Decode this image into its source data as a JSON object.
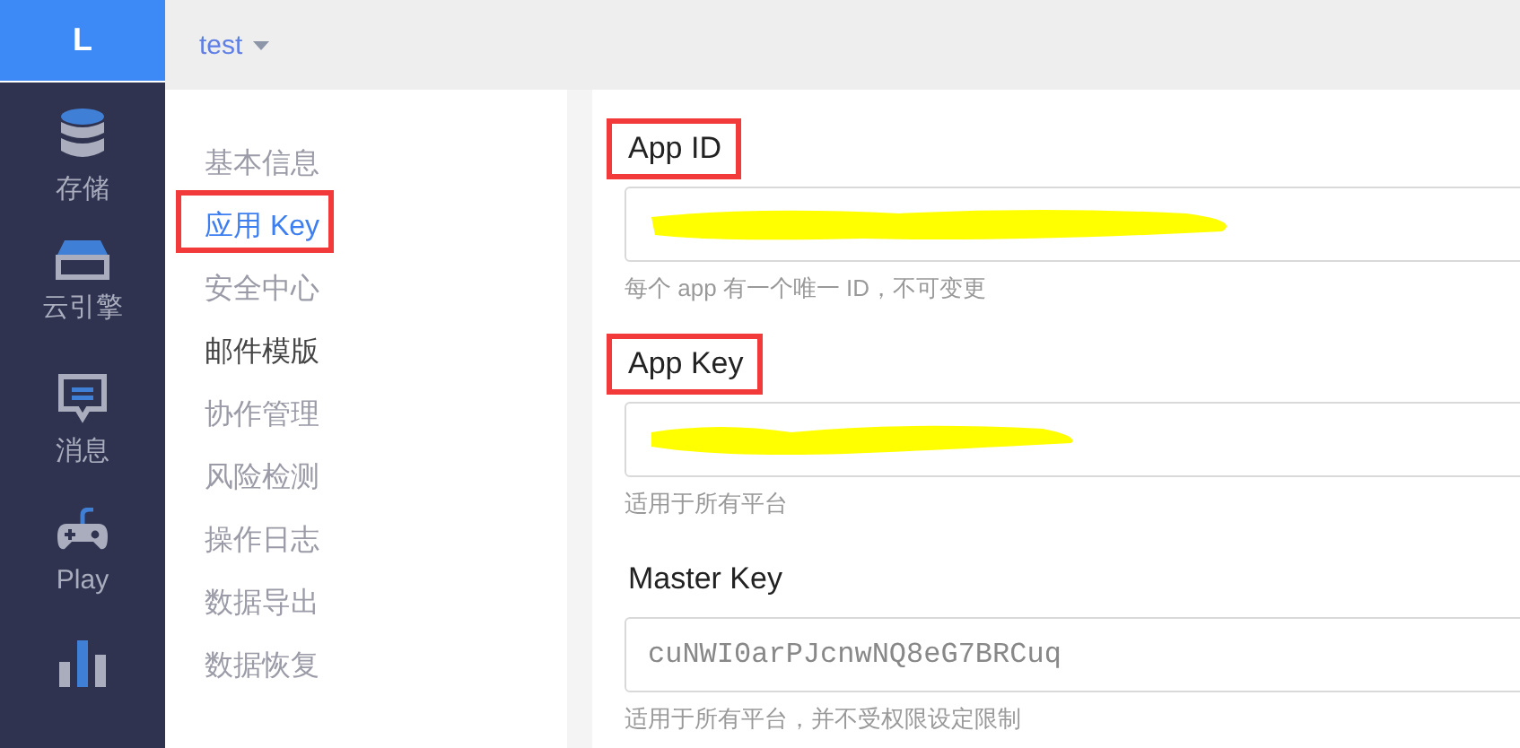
{
  "logo": "L",
  "app_switcher": {
    "label": "test"
  },
  "sidebar": {
    "items": [
      {
        "kind": "database",
        "label": "存储"
      },
      {
        "kind": "server",
        "label": "云引擎"
      },
      {
        "kind": "message",
        "label": "消息"
      },
      {
        "kind": "gamepad",
        "label": "Play"
      },
      {
        "kind": "chart"
      }
    ]
  },
  "submenu": {
    "items": [
      {
        "label": "基本信息",
        "selected": false,
        "hovered": false,
        "annotated": false
      },
      {
        "label": "应用 Key",
        "selected": true,
        "hovered": false,
        "annotated": true
      },
      {
        "label": "安全中心",
        "selected": false,
        "hovered": false,
        "annotated": false
      },
      {
        "label": "邮件模版",
        "selected": false,
        "hovered": true,
        "annotated": false
      },
      {
        "label": "协作管理",
        "selected": false,
        "hovered": false,
        "annotated": false
      },
      {
        "label": "风险检测",
        "selected": false,
        "hovered": false,
        "annotated": false
      },
      {
        "label": "操作日志",
        "selected": false,
        "hovered": false,
        "annotated": false
      },
      {
        "label": "数据导出",
        "selected": false,
        "hovered": false,
        "annotated": false
      },
      {
        "label": "数据恢复",
        "selected": false,
        "hovered": false,
        "annotated": false
      }
    ]
  },
  "fields": [
    {
      "label": "App ID",
      "annotated": true,
      "redacted": true,
      "help": "每个 app 有一个唯一 ID，不可变更"
    },
    {
      "label": "App Key",
      "annotated": true,
      "redacted": true,
      "help": "适用于所有平台"
    },
    {
      "label": "Master Key",
      "annotated": false,
      "value": "cuNWI0arPJcnwNQ8eG7BRCuq",
      "help": "适用于所有平台，并不受权限设定限制"
    }
  ]
}
